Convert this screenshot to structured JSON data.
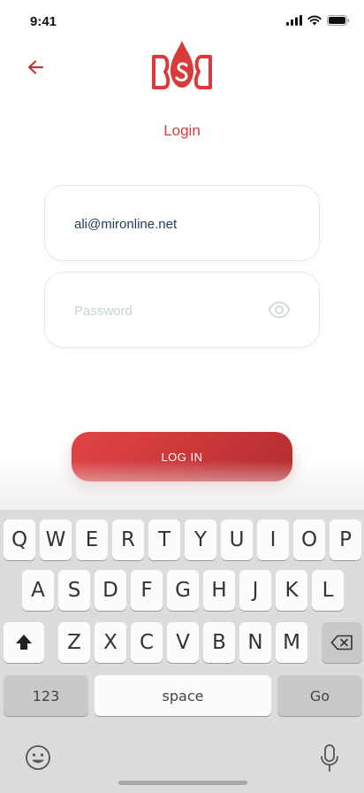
{
  "status_bar": {
    "time": "9:41"
  },
  "header": {
    "logo_text": "BSB"
  },
  "title": "Login",
  "email": {
    "value": "ali@mironline.net",
    "placeholder": ""
  },
  "password": {
    "value": "",
    "placeholder": "Password"
  },
  "login_button": {
    "label": "LOG IN"
  },
  "keyboard": {
    "row1": [
      "Q",
      "W",
      "E",
      "R",
      "T",
      "Y",
      "U",
      "I",
      "O",
      "P"
    ],
    "row2": [
      "A",
      "S",
      "D",
      "F",
      "G",
      "H",
      "J",
      "K",
      "L"
    ],
    "row3": [
      "Z",
      "X",
      "C",
      "V",
      "B",
      "N",
      "M"
    ],
    "numbers_label": "123",
    "space_label": "space",
    "go_label": "Go",
    "icons": [
      "shift-icon",
      "backspace-icon",
      "emoji-icon",
      "microphone-icon"
    ]
  },
  "colors": {
    "accent": "#d93a3a",
    "button_start": "#e24446",
    "button_end": "#b42c2e"
  }
}
